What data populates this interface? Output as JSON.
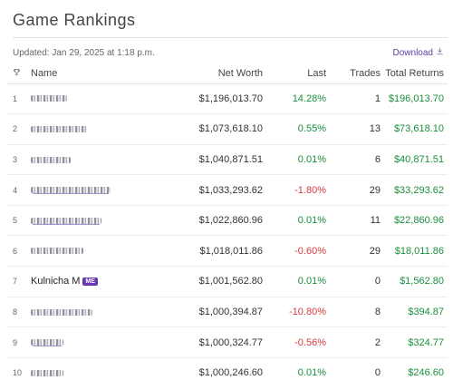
{
  "title": "Game Rankings",
  "updated": "Updated: Jan 29, 2025 at 1:18 p.m.",
  "download_label": "Download",
  "columns": {
    "rank_icon": "trophy-icon",
    "name": "Name",
    "net_worth": "Net Worth",
    "last": "Last",
    "trades": "Trades",
    "total_returns": "Total Returns"
  },
  "colors": {
    "positive": "#1a8f3c",
    "negative": "#d93a3a",
    "accent": "#6a36b8"
  },
  "rows": [
    {
      "rank": "1",
      "name": "",
      "blurred": true,
      "net_worth": "$1,196,013.70",
      "last": "14.28%",
      "last_sign": "pos",
      "trades": "1",
      "total_returns": "$196,013.70"
    },
    {
      "rank": "2",
      "name": "",
      "blurred": true,
      "net_worth": "$1,073,618.10",
      "last": "0.55%",
      "last_sign": "pos",
      "trades": "13",
      "total_returns": "$73,618.10"
    },
    {
      "rank": "3",
      "name": "",
      "blurred": true,
      "net_worth": "$1,040,871.51",
      "last": "0.01%",
      "last_sign": "pos",
      "trades": "6",
      "total_returns": "$40,871.51"
    },
    {
      "rank": "4",
      "name": "",
      "blurred": true,
      "net_worth": "$1,033,293.62",
      "last": "-1.80%",
      "last_sign": "neg",
      "trades": "29",
      "total_returns": "$33,293.62"
    },
    {
      "rank": "5",
      "name": "",
      "blurred": true,
      "net_worth": "$1,022,860.96",
      "last": "0.01%",
      "last_sign": "pos",
      "trades": "11",
      "total_returns": "$22,860.96"
    },
    {
      "rank": "6",
      "name": "",
      "blurred": true,
      "net_worth": "$1,018,011.86",
      "last": "-0.60%",
      "last_sign": "neg",
      "trades": "29",
      "total_returns": "$18,011.86"
    },
    {
      "rank": "7",
      "name": "Kulnicha M",
      "blurred": false,
      "badge": "ME",
      "net_worth": "$1,001,562.80",
      "last": "0.01%",
      "last_sign": "pos",
      "trades": "0",
      "total_returns": "$1,562.80"
    },
    {
      "rank": "8",
      "name": "",
      "blurred": true,
      "net_worth": "$1,000,394.87",
      "last": "-10.80%",
      "last_sign": "neg",
      "trades": "8",
      "total_returns": "$394.87"
    },
    {
      "rank": "9",
      "name": "",
      "blurred": true,
      "net_worth": "$1,000,324.77",
      "last": "-0.56%",
      "last_sign": "neg",
      "trades": "2",
      "total_returns": "$324.77"
    },
    {
      "rank": "10",
      "name": "",
      "blurred": true,
      "net_worth": "$1,000,246.60",
      "last": "0.01%",
      "last_sign": "pos",
      "trades": "0",
      "total_returns": "$246.60"
    }
  ]
}
